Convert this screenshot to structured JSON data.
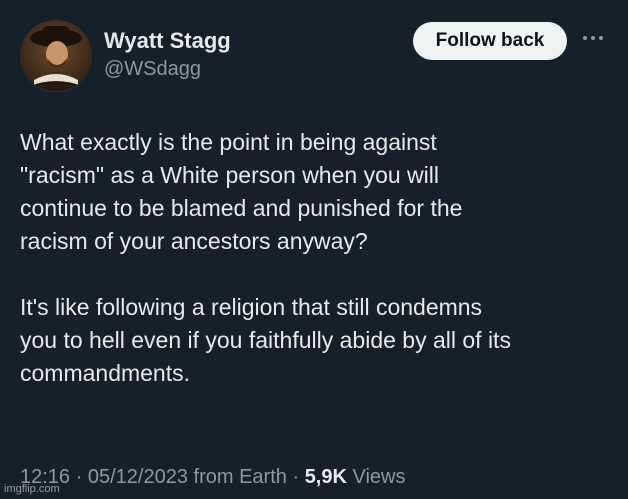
{
  "author": {
    "display_name": "Wyatt Stagg",
    "handle": "@WSdagg"
  },
  "actions": {
    "follow_label": "Follow back",
    "more_icon": "more-horizontal-icon"
  },
  "tweet": {
    "paragraphs": [
      "What exactly is the point in being against\n\"racism\" as a White person when you will\ncontinue to be blamed and punished for the\nracism of your ancestors anyway?",
      "It's like following a religion that still condemns\nyou to hell even if you faithfully abide by all of its\ncommandments."
    ],
    "time": "12:16",
    "separator": "·",
    "date": "05/12/2023",
    "source": "from Earth",
    "views_count": "5,9K",
    "views_label": "Views"
  },
  "watermark": "imgflip.com",
  "colors": {
    "background": "#15202b",
    "text": "#e7e9ea",
    "secondary_text": "#8b98a5",
    "button_bg": "#eff3f4"
  }
}
